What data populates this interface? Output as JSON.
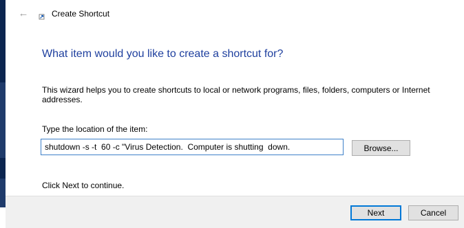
{
  "window": {
    "title": "Create Shortcut",
    "back_icon": "back-arrow-icon",
    "title_icon": "shortcut-icon"
  },
  "main": {
    "heading": "What item would you like to create a shortcut for?",
    "description": "This wizard helps you to create shortcuts to local or network programs, files, folders, computers or Internet addresses.",
    "location_label": "Type the location of the item:",
    "location_value": "shutdown -s -t  60 -c \"Virus Detection.  Computer is shutting  down.",
    "browse_label": "Browse...",
    "continue_text": "Click Next to continue."
  },
  "footer": {
    "next_label": "Next",
    "cancel_label": "Cancel"
  },
  "colors": {
    "heading": "#1e3f9e",
    "focus_border": "#3c7fc8",
    "footer_bg": "#f0f0f0",
    "default_button_border": "#0078d7"
  }
}
